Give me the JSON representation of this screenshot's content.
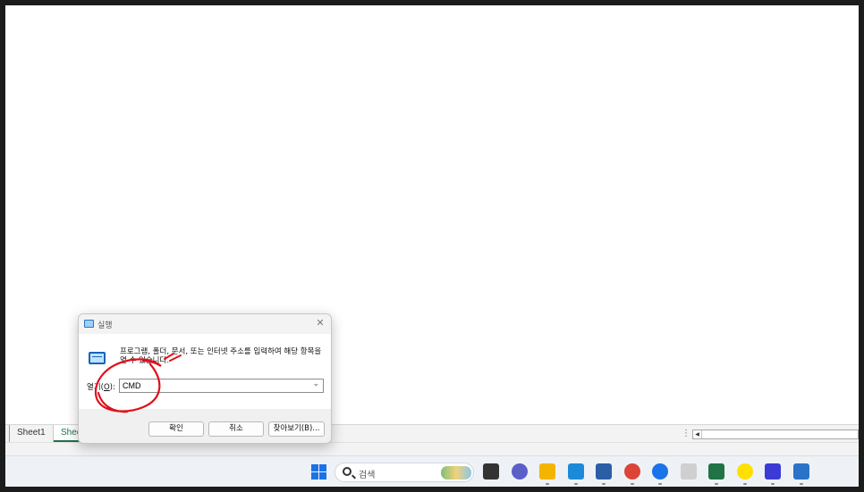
{
  "excel": {
    "sheet_tabs": [
      {
        "label": "Sheet1"
      },
      {
        "label": "Shee"
      }
    ]
  },
  "dialog": {
    "title": "실행",
    "close_glyph": "✕",
    "description": "프로그램, 폴더, 문서, 또는 인터넷 주소를 입력하여 해당 항목을 열 수 있습니다.",
    "open_label_prefix": "열기(",
    "open_label_hotkey": "O",
    "open_label_suffix": "):",
    "open_value": "CMD",
    "buttons": {
      "ok": "확인",
      "cancel": "취소",
      "browse": "찾아보기(B)..."
    }
  },
  "taskbar": {
    "search_placeholder": "검색",
    "icons": [
      {
        "name": "task-view-icon",
        "color": "#333333"
      },
      {
        "name": "meet-icon",
        "color": "#5b5fc7"
      },
      {
        "name": "file-explorer-icon",
        "color": "#f4b400"
      },
      {
        "name": "edge-icon",
        "color": "#1d8ad8"
      },
      {
        "name": "store-icon",
        "color": "#2b5ea7"
      },
      {
        "name": "chrome-icon",
        "color": "#db4437"
      },
      {
        "name": "chat-icon",
        "color": "#1a73e8"
      },
      {
        "name": "app-icon",
        "color": "#cfcfcf"
      },
      {
        "name": "excel-icon",
        "color": "#217346"
      },
      {
        "name": "kakaotalk-icon",
        "color": "#ffe000"
      },
      {
        "name": "f-app-icon",
        "color": "#3b3bd6"
      },
      {
        "name": "run-app-icon",
        "color": "#2a73c9"
      }
    ]
  },
  "annotation_color": "#e0101a"
}
